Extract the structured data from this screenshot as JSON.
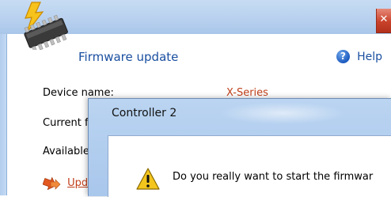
{
  "main_window": {
    "title": "Firmware update",
    "close_glyph": "✕",
    "help": {
      "icon": "help-icon",
      "glyph": "?",
      "label": "Help"
    },
    "fields": [
      {
        "label": "Device name:",
        "value": "X-Series"
      },
      {
        "label": "Current fi"
      },
      {
        "label": "Available"
      }
    ],
    "update_link": {
      "icon": "update-arrow-icon",
      "label": "Upda"
    }
  },
  "dialog": {
    "title": "Controller 2",
    "icon": "warning-icon",
    "message": "Do you really want to start the firmwar"
  },
  "colors": {
    "titlebar": "#b7d0ee",
    "link_blue": "#1a4fa0",
    "accent_red": "#c0401b",
    "close_red": "#c9422b",
    "warning_yellow": "#f3c51d"
  }
}
